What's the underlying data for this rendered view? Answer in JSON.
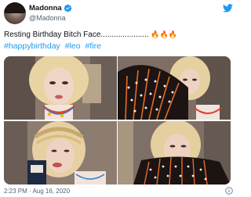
{
  "author": {
    "display_name": "Madonna",
    "handle": "@Madonna",
    "verified": true
  },
  "tweet": {
    "text": "Resting Birthday Bitch Face......................",
    "emoji": "🔥🔥🔥",
    "hashtags": [
      "#happybirthday",
      "#leo",
      "#fire"
    ]
  },
  "media": [
    {
      "label": "photo-1"
    },
    {
      "label": "photo-2"
    },
    {
      "label": "photo-3"
    },
    {
      "label": "photo-4"
    }
  ],
  "meta": {
    "timestamp": "2:23 PM · Aug 16, 2020"
  },
  "icons": {
    "verified": "verified-badge-icon",
    "brand": "twitter-bird-icon",
    "info": "info-icon"
  },
  "colors": {
    "link": "#1d9bf0",
    "secondary_text": "#536471",
    "verified": "#1d9bf0"
  }
}
